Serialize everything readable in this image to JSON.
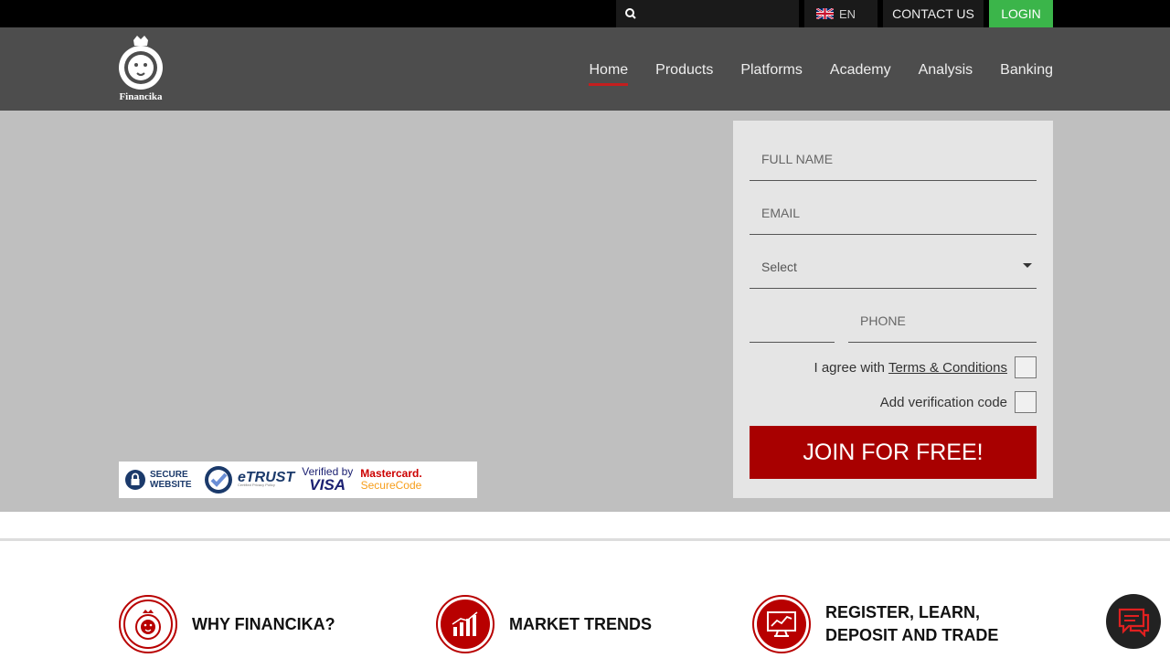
{
  "topbar": {
    "search_placeholder": "",
    "language": "EN",
    "contact_label": "CONTACT US",
    "login_label": "LOGIN",
    "login_color": "#3bb54a"
  },
  "brand": {
    "name": "Financika"
  },
  "nav": {
    "items": [
      {
        "label": "Home",
        "active": true
      },
      {
        "label": "Products"
      },
      {
        "label": "Platforms"
      },
      {
        "label": "Academy"
      },
      {
        "label": "Analysis"
      },
      {
        "label": "Banking"
      }
    ],
    "accent": "#c41e1e"
  },
  "badges": {
    "secure": "SECURE WEBSITE",
    "etrust": "eTRUST",
    "etrust_sub": "Certified Privacy Policy",
    "visa_top": "Verified by",
    "visa_bottom": "VISA",
    "mc_top": "Mastercard.",
    "mc_bottom": "SecureCode"
  },
  "form": {
    "full_name_placeholder": "FULL NAME",
    "email_placeholder": "EMAIL",
    "select_value": "Select",
    "phone_placeholder": "PHONE",
    "terms_prefix": "I agree with ",
    "terms_link": "Terms & Conditions",
    "verification_label": "Add verification code",
    "submit_label": "JOIN FOR FREE!",
    "submit_color": "#a80000"
  },
  "features": [
    {
      "label": "WHY FINANCIKA?",
      "icon": "lion-icon"
    },
    {
      "label": "MARKET TRENDS",
      "icon": "bar-chart-icon"
    },
    {
      "label": "REGISTER, LEARN, DEPOSIT AND TRADE",
      "icon": "monitor-chart-icon"
    }
  ]
}
